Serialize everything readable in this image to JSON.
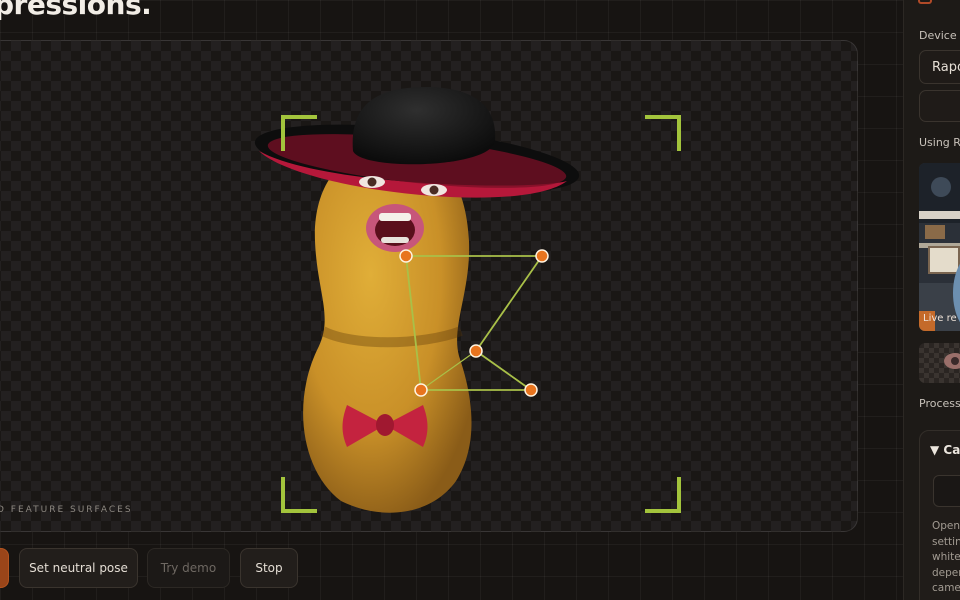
{
  "heading": {
    "title": "pressions."
  },
  "stage": {
    "caption": "D FEATURE SURFACES",
    "rig_points": [
      {
        "name": "upper-left"
      },
      {
        "name": "upper-right"
      },
      {
        "name": "middle"
      },
      {
        "name": "lower-left"
      },
      {
        "name": "lower-right"
      }
    ]
  },
  "actions": {
    "primary_label": "",
    "neutral_label": "Set neutral pose",
    "demo_label": "Try demo",
    "stop_label": "Stop"
  },
  "panel": {
    "device_label": "Device",
    "device_value": "Rapo",
    "using_label": "Using Ra",
    "preview_caption": "Live re",
    "processed_label": "Processe",
    "card_title": "▼ Ca",
    "card_text": [
      "Opens",
      "setting",
      "white",
      "deper",
      "came"
    ]
  },
  "colors": {
    "accent_bracket": "#a3c43c",
    "rig_point": "#e8741e",
    "rig_line": "#a9c048",
    "primary_button": "#9a4519"
  }
}
